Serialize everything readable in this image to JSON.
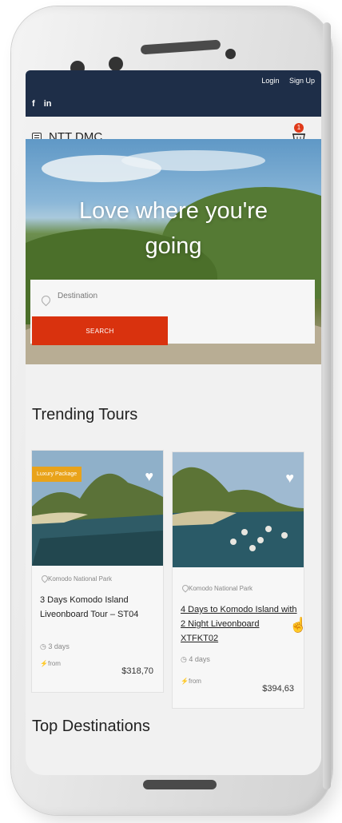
{
  "topbar": {
    "social": [
      "f",
      "in"
    ],
    "login": "Login",
    "signup": "Sign Up"
  },
  "navbar": {
    "brand": "NTT DMC",
    "cart_count": "1"
  },
  "hero": {
    "title_line1": "Love where you're",
    "title_line2": "going",
    "search_placeholder": "Destination",
    "search_button": "SEARCH"
  },
  "trending": {
    "title": "Trending Tours",
    "cards": [
      {
        "badge": "Luxury Package",
        "location": "Komodo National Park",
        "title": "3 Days Komodo Island Liveonboard Tour – ST04",
        "duration": "3 days",
        "from": "from",
        "price": "$318,70"
      },
      {
        "location": "Komodo National Park",
        "title": "4 Days to Komodo Island with 2 Night Liveonboard XTFKT02",
        "duration": "4 days",
        "from": "from",
        "price": "$394,63"
      }
    ]
  },
  "destinations": {
    "title": "Top Destinations"
  }
}
